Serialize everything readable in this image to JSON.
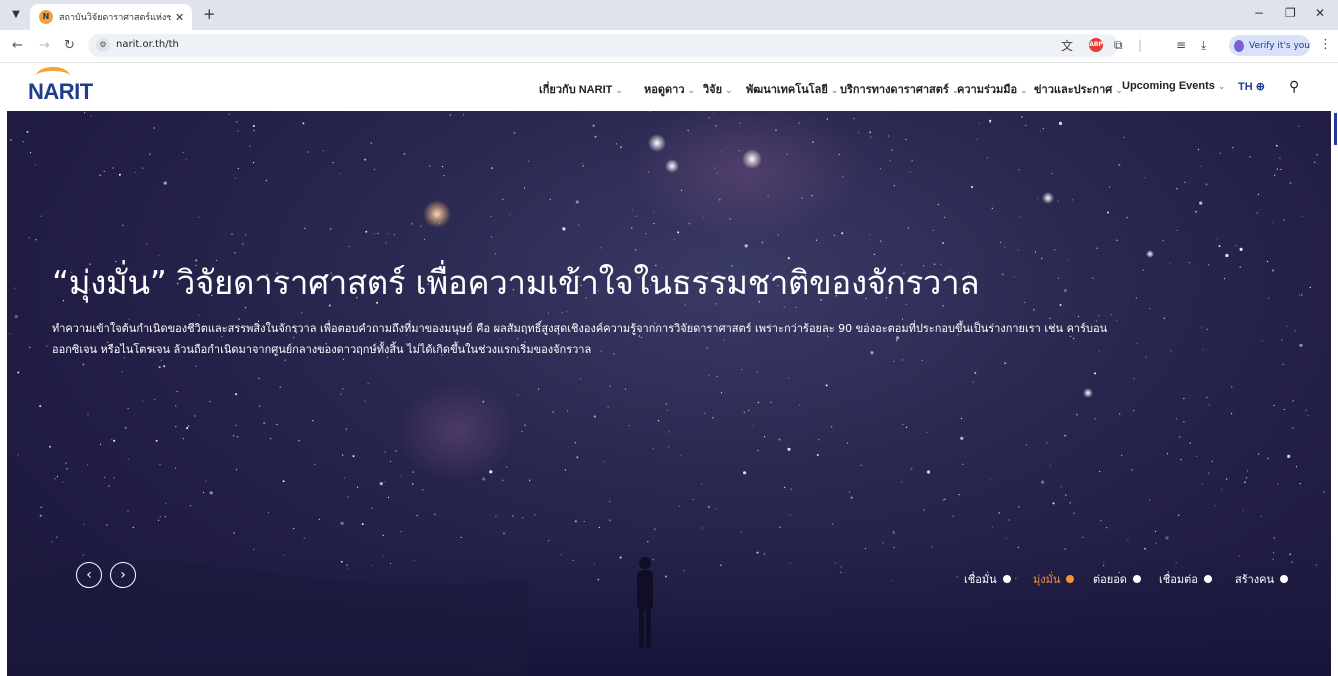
{
  "browser": {
    "tab_title": "สถาบันวิจัยดาราศาสตร์แห่งชาติ (องค์",
    "url": "narit.or.th/th",
    "verify_label": "Verify it's you",
    "favicon_text": "NARIT"
  },
  "header": {
    "logo_text": "NARIT",
    "nav": [
      {
        "label": "เกี่ยวกับ NARIT"
      },
      {
        "label": "หอดูดาว"
      },
      {
        "label": "วิจัย"
      },
      {
        "label": "พัฒนาเทคโนโลยี"
      },
      {
        "label": "บริการทางดาราศาสตร์"
      },
      {
        "label": "ความร่วมมือ"
      },
      {
        "label": "ข่าวและประกาศ"
      },
      {
        "label": "Upcoming Events"
      }
    ],
    "lang_label": "TH"
  },
  "hero": {
    "title": "“มุ่งมั่น” วิจัยดาราศาสตร์ เพื่อความเข้าใจในธรรมชาติของจักรวาล",
    "description_line1": "ทำความเข้าใจต้นกำเนิดของชีวิตและสรรพสิ่งในจักรวาล เพื่อตอบคำถามถึงที่มาของมนุษย์ คือ ผลสัมฤทธิ์สูงสุดเชิงองค์ความรู้จากการวิจัยดาราศาสตร์ เพราะกว่าร้อยละ 90 ของอะตอมที่ประกอบขึ้นเป็นร่างกายเรา เช่น คาร์บอน",
    "description_line2": "ออกซิเจน หรือไนโตรเจน ล้วนถือกำเนิดมาจากศูนย์กลางของดาวฤกษ์ทั้งสิ้น ไม่ได้เกิดขึ้นในช่วงแรกเริ่มของจักรวาล",
    "slides": [
      {
        "label": "เชื่อมั่น",
        "active": false
      },
      {
        "label": "มุ่งมั่น",
        "active": true
      },
      {
        "label": "ต่อยอด",
        "active": false
      },
      {
        "label": "เชื่อมต่อ",
        "active": false
      },
      {
        "label": "สร้างคน",
        "active": false
      }
    ]
  },
  "colors": {
    "brand_blue": "#1f3d8c",
    "brand_orange": "#f2a33a",
    "active_slide": "#f5913b"
  }
}
